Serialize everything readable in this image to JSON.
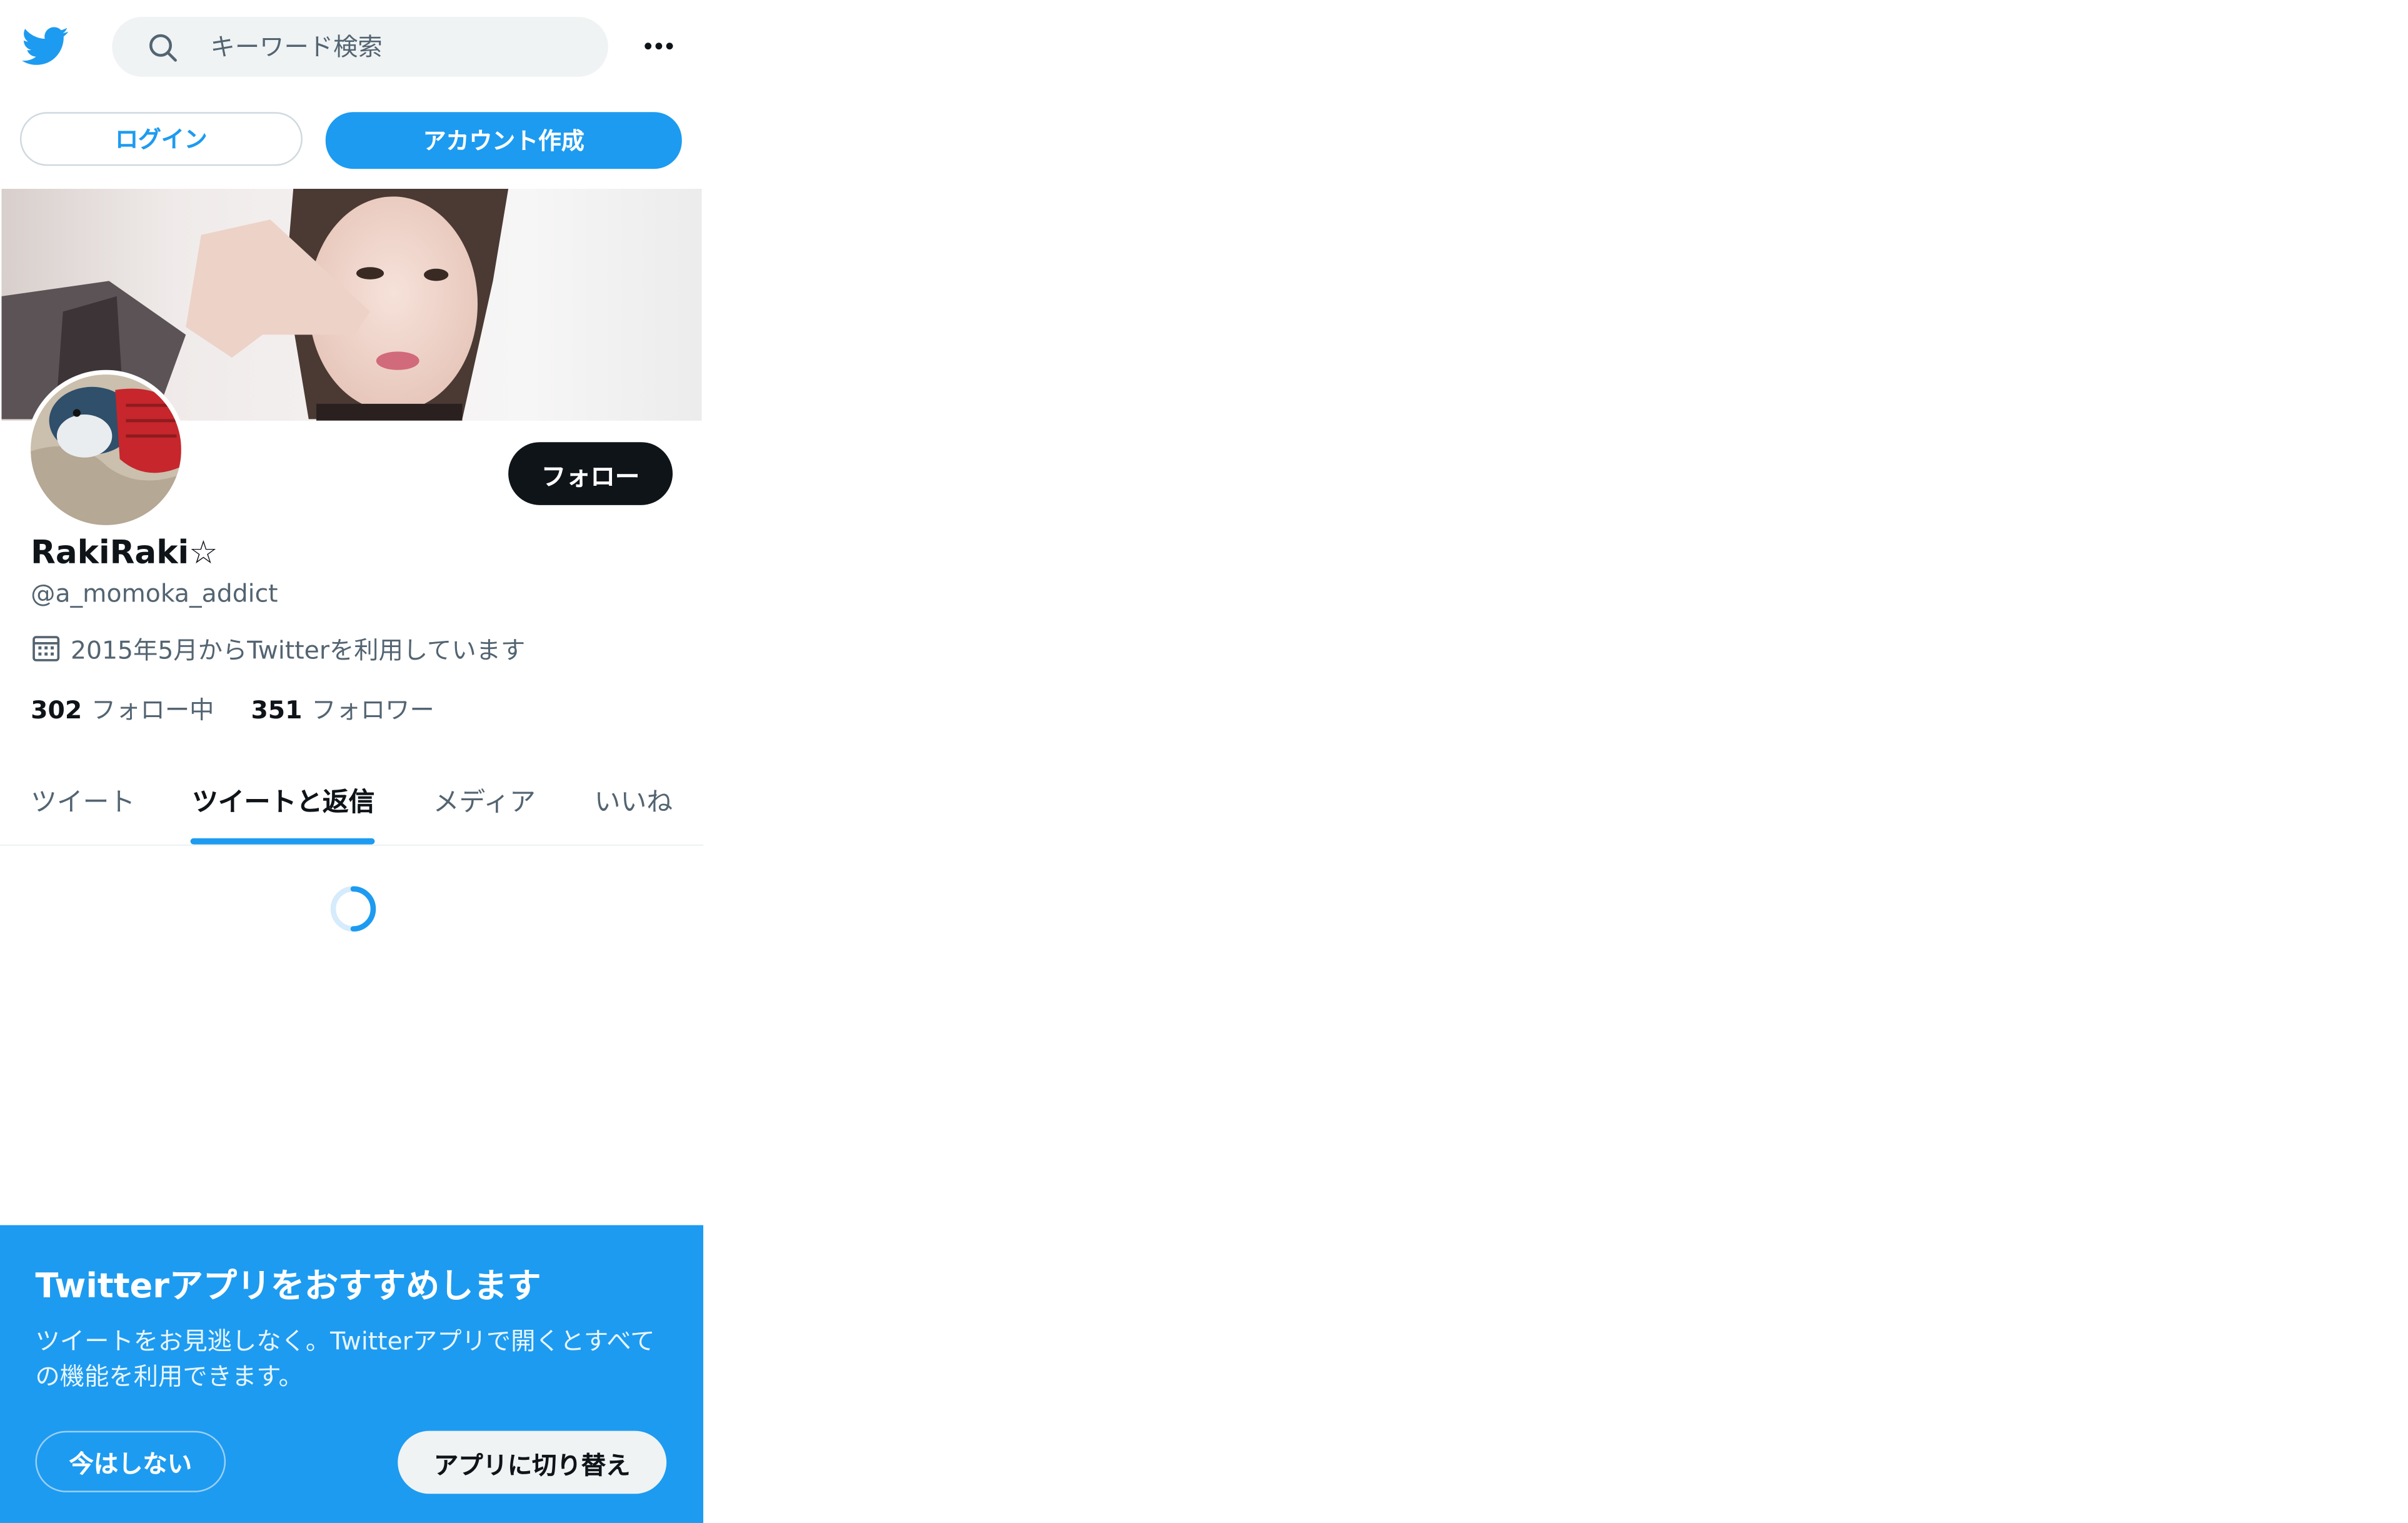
{
  "header": {
    "logo_icon": "twitter-bird-icon",
    "search_icon": "search-icon",
    "search_placeholder": "キーワード検索",
    "more_icon": "more-horizontal-icon"
  },
  "auth": {
    "login_label": "ログイン",
    "signup_label": "アカウント作成"
  },
  "profile": {
    "follow_label": "フォロー",
    "display_name": "RakiRaki☆",
    "handle": "@a_momoka_addict",
    "calendar_icon": "calendar-icon",
    "joined": "2015年5月からTwitterを利用しています",
    "following_count": "302",
    "following_label": "フォロー中",
    "followers_count": "351",
    "followers_label": "フォロワー"
  },
  "tabs": [
    {
      "label": "ツイート",
      "active": false
    },
    {
      "label": "ツイートと返信",
      "active": true
    },
    {
      "label": "メディア",
      "active": false
    },
    {
      "label": "いいね",
      "active": false
    }
  ],
  "promo": {
    "title": "Twitterアプリをおすすめします",
    "body": "ツイートをお見逃しなく。Twitterアプリで開くとすべての機能を利用できます。",
    "not_now_label": "今はしない",
    "switch_label": "アプリに切り替え"
  },
  "colors": {
    "accent": "#1d9bf0",
    "text_primary": "#0f1419",
    "text_secondary": "#536471",
    "background": "#ffffff"
  }
}
